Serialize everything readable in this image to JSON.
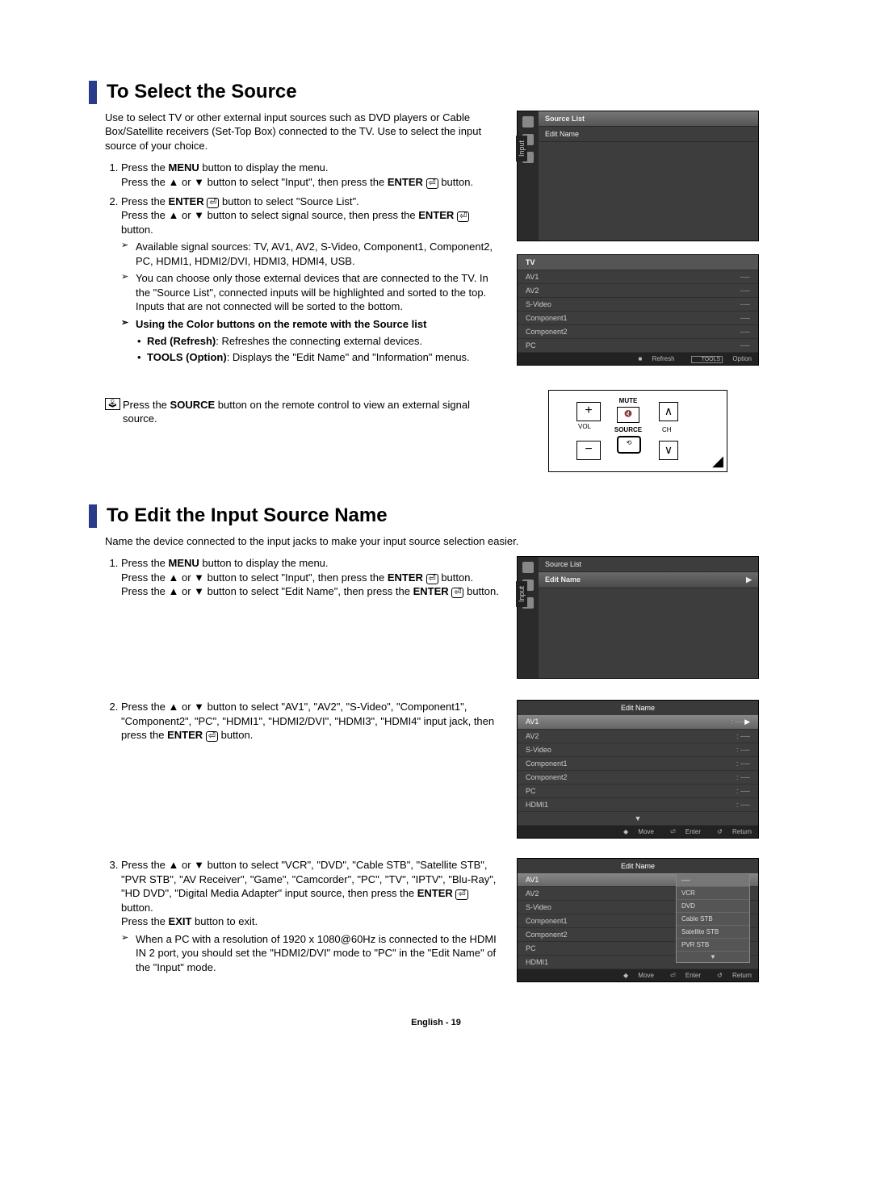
{
  "section1": {
    "heading": "To Select the Source",
    "intro": "Use to select TV or other external input sources such as DVD players or Cable Box/Satellite receivers (Set-Top Box) connected to the TV. Use to select the input source of your choice.",
    "step1a": "Press the ",
    "step1b": "MENU",
    "step1c": " button to display the menu.",
    "step1d": "Press the ▲ or ▼ button to select \"Input\", then press the ",
    "step1e": "ENTER",
    "step1f": " button.",
    "step2a": "Press the ",
    "step2b": "ENTER",
    "step2c": " button to select \"Source List\".",
    "step2d": "Press the ▲ or ▼ button to select signal source, then press the ",
    "step2e": "ENTER",
    "step2f": " button.",
    "sub1": "Available signal sources: TV, AV1, AV2, S-Video, Component1, Component2, PC, HDMI1, HDMI2/DVI, HDMI3, HDMI4, USB.",
    "sub2": "You can choose only those external devices that are connected to the TV. In the \"Source List\", connected inputs will be highlighted and sorted to the top. Inputs that are not connected will be sorted to the bottom.",
    "sub3": "Using the Color buttons on the remote with the Source list",
    "b1a": "Red (Refresh)",
    "b1b": ": Refreshes the connecting external devices.",
    "b2a": "TOOLS (Option)",
    "b2b": ": Displays the \"Edit Name\" and \"Information\" menus.",
    "remote_a": "Press the ",
    "remote_b": "SOURCE",
    "remote_c": " button on the remote control to view an external signal source."
  },
  "tvpanel1": {
    "tab": "Input",
    "row1": "Source List",
    "row2": "Edit Name"
  },
  "srclist": {
    "head": "TV",
    "items": [
      {
        "nm": "AV1",
        "val": "----"
      },
      {
        "nm": "AV2",
        "val": "----"
      },
      {
        "nm": "S-Video",
        "val": "----"
      },
      {
        "nm": "Component1",
        "val": "----"
      },
      {
        "nm": "Component2",
        "val": "----"
      },
      {
        "nm": "PC",
        "val": "----"
      }
    ],
    "foot_refresh": "Refresh",
    "foot_option": "Option",
    "foot_tools": "TOOLS"
  },
  "remote": {
    "mute": "MUTE",
    "vol": "VOL",
    "source": "SOURCE",
    "ch": "CH"
  },
  "section2": {
    "heading": "To Edit the Input Source Name",
    "intro": "Name the device connected to the input jacks to make your input source selection easier.",
    "s1a": "Press the ",
    "s1b": "MENU",
    "s1c": " button to display the menu.",
    "s1d": "Press the ▲ or ▼ button to select \"Input\", then press the ",
    "s1e": "ENTER",
    "s1f": " button.",
    "s1g": "Press the ▲ or ▼ button to select \"Edit Name\", then press the ",
    "s1h": "ENTER",
    "s1i": " button.",
    "s2a": "Press the ▲ or ▼ button to select \"AV1\", \"AV2\", \"S-Video\", \"Component1\", \"Component2\", \"PC\", \"HDMI1\", \"HDMI2/DVI\", \"HDMI3\", \"HDMI4\" input jack, then press the ",
    "s2b": "ENTER",
    "s2c": " button.",
    "s3a": "Press the ▲ or ▼ button to select \"VCR\", \"DVD\", \"Cable STB\", \"Satellite STB\", \"PVR STB\", \"AV Receiver\", \"Game\", \"Camcorder\", \"PC\", \"TV\", \"IPTV\", \"Blu-Ray\", \"HD DVD\", \"Digital Media Adapter\" input source, then press the ",
    "s3b": "ENTER",
    "s3c": " button.",
    "s3d": "Press the ",
    "s3e": "EXIT",
    "s3f": " button to exit.",
    "sub": "When a PC with a resolution of 1920 x 1080@60Hz is connected to the HDMI IN 2 port, you should set the \"HDMI2/DVI\" mode to \"PC\" in the \"Edit Name\" of the \"Input\" mode."
  },
  "tvpanel2": {
    "tab": "Input",
    "row1": "Source List",
    "row2": "Edit Name"
  },
  "editlist": {
    "title": "Edit Name",
    "items": [
      {
        "nm": "AV1",
        "val": "----"
      },
      {
        "nm": "AV2",
        "val": "----"
      },
      {
        "nm": "S-Video",
        "val": "----"
      },
      {
        "nm": "Component1",
        "val": "----"
      },
      {
        "nm": "Component2",
        "val": "----"
      },
      {
        "nm": "PC",
        "val": "----"
      },
      {
        "nm": "HDMI1",
        "val": "----"
      }
    ],
    "move": "Move",
    "enter": "Enter",
    "return": "Return"
  },
  "editpopup": {
    "title": "Edit Name",
    "items": [
      {
        "nm": "AV1"
      },
      {
        "nm": "AV2"
      },
      {
        "nm": "S-Video"
      },
      {
        "nm": "Component1"
      },
      {
        "nm": "Component2"
      },
      {
        "nm": "PC"
      },
      {
        "nm": "HDMI1"
      }
    ],
    "options": [
      "----",
      "VCR",
      "DVD",
      "Cable STB",
      "Satellite STB",
      "PVR STB"
    ],
    "move": "Move",
    "enter": "Enter",
    "return": "Return"
  },
  "footer": "English - 19"
}
